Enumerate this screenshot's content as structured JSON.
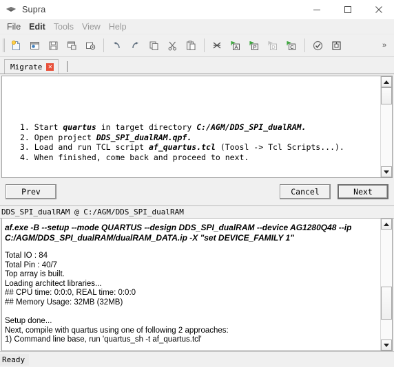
{
  "window": {
    "title": "Supra",
    "app_icon": "gem-icon",
    "controls": {
      "minimize": "minimize-icon",
      "maximize": "maximize-icon",
      "close": "close-icon"
    }
  },
  "menubar": {
    "items": [
      {
        "label": "File",
        "state": "normal"
      },
      {
        "label": "Edit",
        "state": "bold"
      },
      {
        "label": "Tools",
        "state": "dim"
      },
      {
        "label": "View",
        "state": "dim"
      },
      {
        "label": "Help",
        "state": "dim"
      }
    ]
  },
  "toolbar": {
    "overflow_label": "»",
    "groups": [
      [
        {
          "name": "new-file-icon",
          "tip": "New"
        },
        {
          "name": "open-project-icon",
          "tip": "Open"
        },
        {
          "name": "save-icon",
          "tip": "Save"
        },
        {
          "name": "save-as-icon",
          "tip": "Save As"
        },
        {
          "name": "settings-project-icon",
          "tip": "Project Settings"
        }
      ],
      [
        {
          "name": "undo-icon",
          "tip": "Undo"
        },
        {
          "name": "redo-icon",
          "tip": "Redo"
        },
        {
          "name": "copy-icon",
          "tip": "Copy"
        },
        {
          "name": "cut-icon",
          "tip": "Cut"
        },
        {
          "name": "paste-icon",
          "tip": "Paste"
        }
      ],
      [
        {
          "name": "netlist-icon",
          "tip": "Netlist"
        },
        {
          "name": "run-analysis-icon",
          "tip": "Run A",
          "letter": "A"
        },
        {
          "name": "run-place-icon",
          "tip": "Run P",
          "letter": "P"
        },
        {
          "name": "run-download-icon",
          "tip": "Run D",
          "letter": "D"
        },
        {
          "name": "run-compile-icon",
          "tip": "Run C",
          "letter": "C"
        }
      ],
      [
        {
          "name": "check-icon",
          "tip": "Check"
        },
        {
          "name": "program-icon",
          "tip": "Program"
        }
      ]
    ]
  },
  "tabs": [
    {
      "label": "Migrate",
      "closable": true,
      "active": true
    }
  ],
  "wizard": {
    "steps": [
      {
        "num": "1.",
        "parts": [
          {
            "t": "Start ",
            "style": "normal"
          },
          {
            "t": "quartus",
            "style": "bolditalic"
          },
          {
            "t": " in target directory ",
            "style": "normal"
          },
          {
            "t": "C:/AGM/DDS_SPI_dualRAM.",
            "style": "bolditalic"
          }
        ]
      },
      {
        "num": "2.",
        "parts": [
          {
            "t": "Open project ",
            "style": "normal"
          },
          {
            "t": "DDS_SPI_dualRAM.qpf.",
            "style": "bolditalic"
          }
        ]
      },
      {
        "num": "3.",
        "parts": [
          {
            "t": "Load and run TCL script ",
            "style": "normal"
          },
          {
            "t": "af_quartus.tcl",
            "style": "bolditalic"
          },
          {
            "t": " (Toosl -> Tcl Scripts...).",
            "style": "normal"
          }
        ]
      },
      {
        "num": "4.",
        "parts": [
          {
            "t": "When finished, come back and proceed to next.",
            "style": "normal"
          }
        ]
      }
    ],
    "buttons": {
      "prev": "Prev",
      "cancel": "Cancel",
      "next": "Next"
    },
    "scrollbar": {
      "up_arrow": "scroll-up-icon",
      "down_arrow": "scroll-down-icon",
      "thumb_top_pct": 0,
      "thumb_height_pct": 22
    }
  },
  "console": {
    "header": "DDS_SPI_dualRAM @ C:/AGM/DDS_SPI_dualRAM",
    "command": "af.exe -B --setup --mode QUARTUS --design DDS_SPI_dualRAM --device AG1280Q48 --ip C:/AGM/DDS_SPI_dualRAM/dualRAM_DATA.ip -X \"set DEVICE_FAMILY 1\"",
    "lines": [
      "Total IO  : 84",
      "Total Pin : 40/7",
      "Top array is built.",
      "Loading architect libraries...",
      "## CPU time: 0:0:0, REAL time: 0:0:0",
      "## Memory Usage: 32MB (32MB)",
      "",
      "Setup done...",
      "Next, compile with quartus using one of following 2 approaches:",
      "  1) Command line base, run 'quartus_sh -t af_quartus.tcl'"
    ],
    "scrollbar": {
      "up_arrow": "scroll-up-icon",
      "down_arrow": "scroll-down-icon",
      "thumb_top_pct": 52,
      "thumb_height_pct": 30
    }
  },
  "statusbar": {
    "text": "Ready"
  }
}
